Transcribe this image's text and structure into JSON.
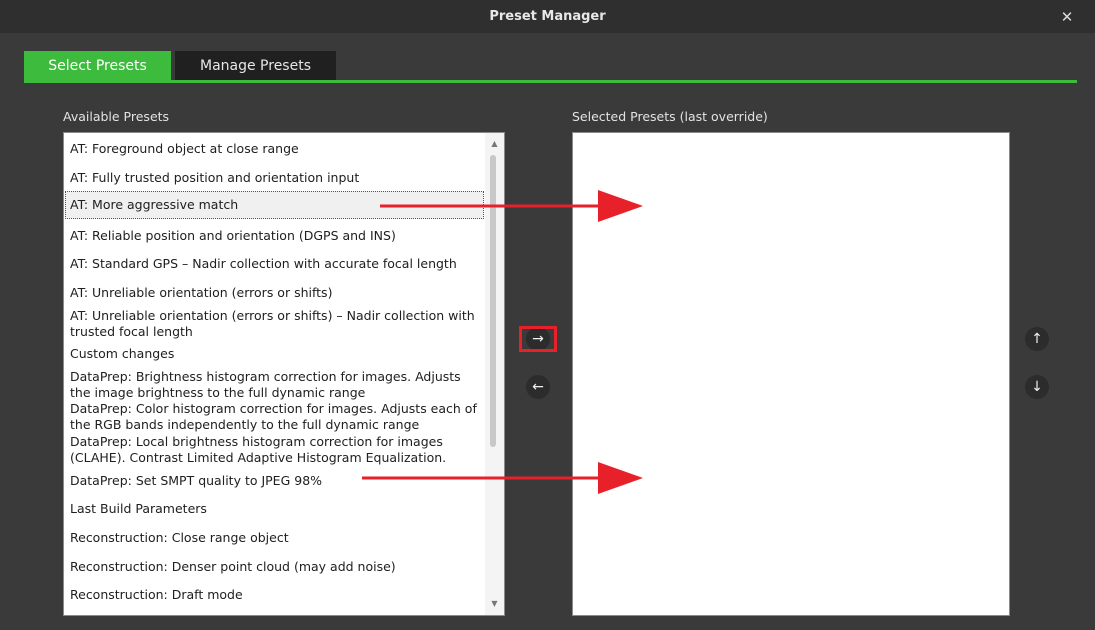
{
  "window": {
    "title": "Preset Manager",
    "close_glyph": "✕"
  },
  "tabs": [
    {
      "label": "Select Presets",
      "active": true
    },
    {
      "label": "Manage Presets",
      "active": false
    }
  ],
  "available": {
    "label": "Available Presets",
    "items": [
      "AT: Foreground object at close range",
      "AT: Fully trusted position and orientation input",
      "AT: More aggressive match",
      "AT: Reliable position and orientation (DGPS and INS)",
      "AT: Standard GPS – Nadir collection with accurate focal length",
      "AT: Unreliable orientation (errors or shifts)",
      "AT: Unreliable orientation (errors or shifts) – Nadir collection with trusted focal length",
      "Custom changes",
      "DataPrep: Brightness histogram correction for images. Adjusts the image brightness to the full dynamic range",
      "DataPrep: Color histogram correction for images. Adjusts each of the RGB bands independently to the full dynamic range",
      "DataPrep: Local brightness histogram correction for images (CLAHE). Contrast Limited Adaptive Histogram Equalization.",
      "DataPrep: Set SMPT quality to JPEG 98%",
      "Last Build Parameters",
      "Reconstruction: Close range object",
      "Reconstruction: Denser point cloud (may add noise)",
      "Reconstruction: Draft mode"
    ],
    "selected_index": 2
  },
  "selected": {
    "label": "Selected Presets (last override)",
    "items": []
  },
  "buttons": {
    "add": "→",
    "remove": "←",
    "move_up": "↑",
    "move_down": "↓"
  },
  "scrollbar": {
    "up_glyph": "▲",
    "down_glyph": "▼"
  },
  "annotation": {
    "color": "#e8202a"
  }
}
